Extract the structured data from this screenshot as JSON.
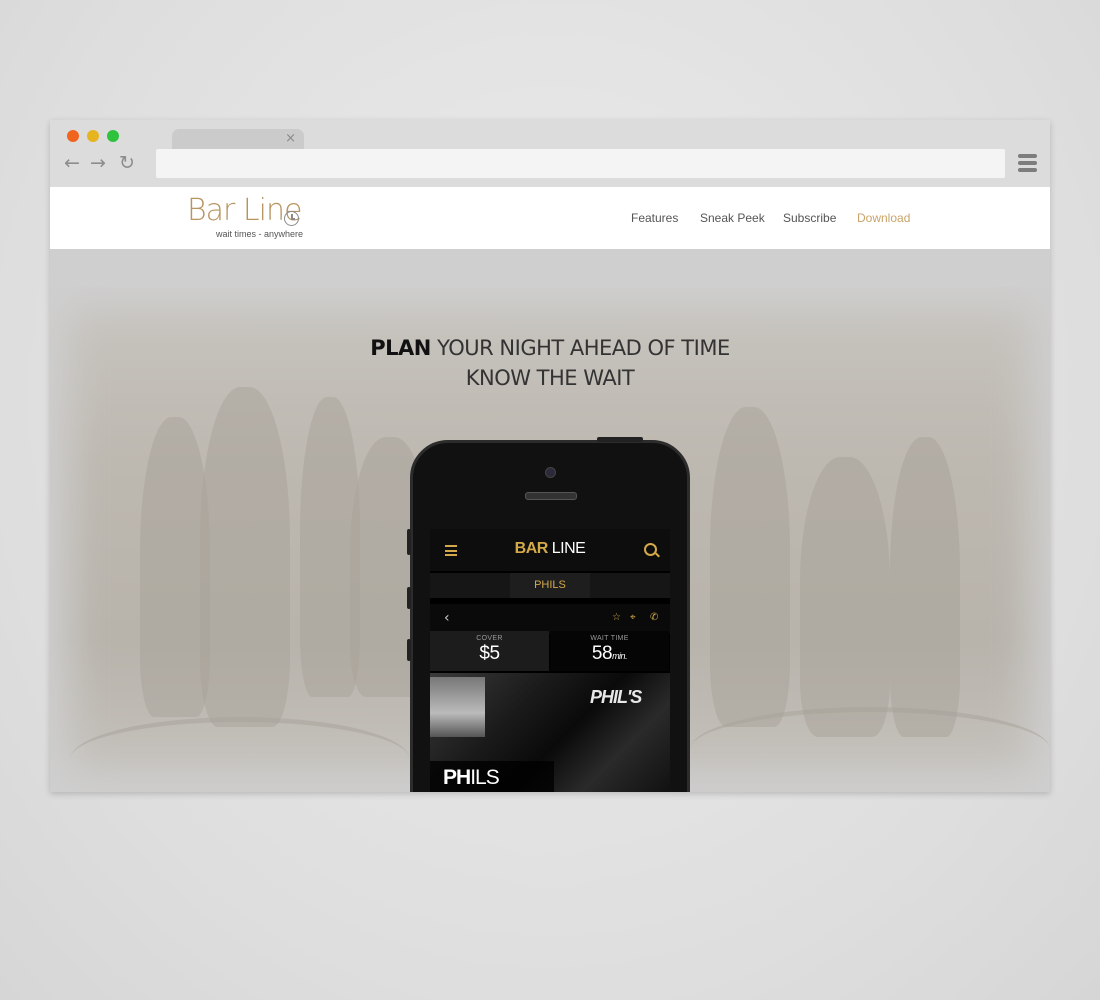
{
  "browser": {
    "tab_close": "×",
    "back_icon": "arrow-left",
    "forward_icon": "arrow-right",
    "reload_icon": "reload",
    "url": ""
  },
  "site": {
    "logo_text": "Bar Line",
    "logo_tagline": "wait times - anywhere",
    "nav": {
      "features": "Features",
      "sneak_peek": "Sneak Peek",
      "subscribe": "Subscribe",
      "download": "Download"
    },
    "accent_color": "#c9a46a"
  },
  "hero": {
    "headline_bold": "PLAN",
    "headline_rest": " YOUR NIGHT AHEAD OF TIME",
    "headline_line2": "KNOW THE WAIT"
  },
  "app": {
    "title_bold": "BAR",
    "title_rest": " LINE",
    "venue_tab": "PHILS",
    "back": "‹",
    "star_icon": "☆",
    "pin_icon": "⌖",
    "phone_icon": "✆",
    "cover_label": "COVER",
    "cover_value": "$5",
    "wait_label": "WAIT TIME",
    "wait_value": "58",
    "wait_unit": "min.",
    "photo_sign": "PHIL'S",
    "venue_caption_bold": "PH",
    "venue_caption_rest": "ILS"
  }
}
